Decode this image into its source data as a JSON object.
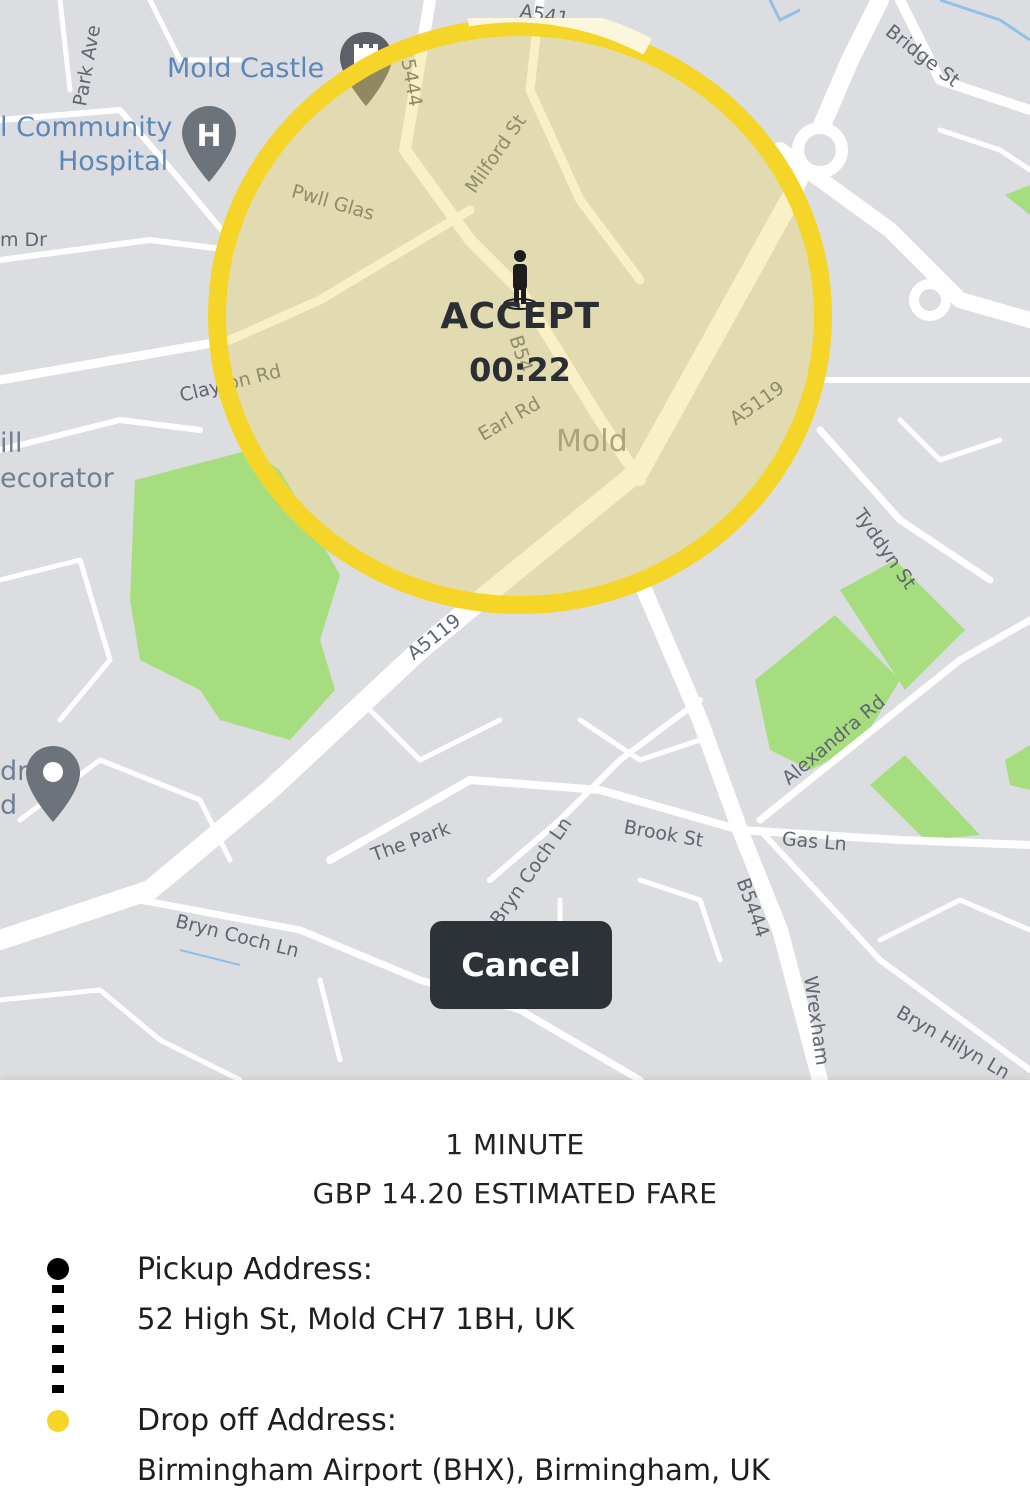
{
  "map": {
    "labels": {
      "park_ave": "Park Ave",
      "mold_castle": "Mold Castle",
      "community": "l Community",
      "hospital": "Hospital",
      "m_dr": "m Dr",
      "pwll_glas": "Pwll Glas",
      "milford_st": "Milford St",
      "clayton_rd": "Clayton Rd",
      "earl_rd": "Earl Rd",
      "mold": "Mold",
      "a5119_right": "A5119",
      "a5119_left": "A5119",
      "ill": "ill",
      "ecorator": "ecorator",
      "bridge_st": "Bridge St",
      "a541": "A541",
      "b5444_top": "B5444",
      "b54_mid": "B54",
      "tyddyn_st": "Tyddyn St",
      "alexandra_rd": "Alexandra Rd",
      "the_park": "The Park",
      "brook_st": "Brook St",
      "gas_ln": "Gas Ln",
      "bryn_coch_ln_left": "Bryn Coch Ln",
      "bryn_coch_ln_mid": "Bryn Coch Ln",
      "b5444_bottom": "B5444",
      "wrexham": "Wrexham",
      "bryn_hilyn_ln": "Bryn Hilyn Ln",
      "dr": "dr",
      "d": "d"
    },
    "colors": {
      "land": "#dcdde0",
      "road": "#ffffff",
      "park": "#a6dd7e",
      "ring": "#f5d628"
    }
  },
  "accept": {
    "label": "ACCEPT",
    "timer": "00:22",
    "countdown_fraction": 0.9
  },
  "cancel_button": {
    "label": "Cancel"
  },
  "trip": {
    "eta": "1 MINUTE",
    "fare": "GBP 14.20 ESTIMATED FARE",
    "pickup_title": "Pickup Address:",
    "pickup_address": "52 High St, Mold CH7 1BH, UK",
    "dropoff_title": "Drop off Address:",
    "dropoff_address": "Birmingham Airport (BHX), Birmingham, UK",
    "pickup_color": "#000000",
    "dropoff_color": "#f5d628"
  }
}
